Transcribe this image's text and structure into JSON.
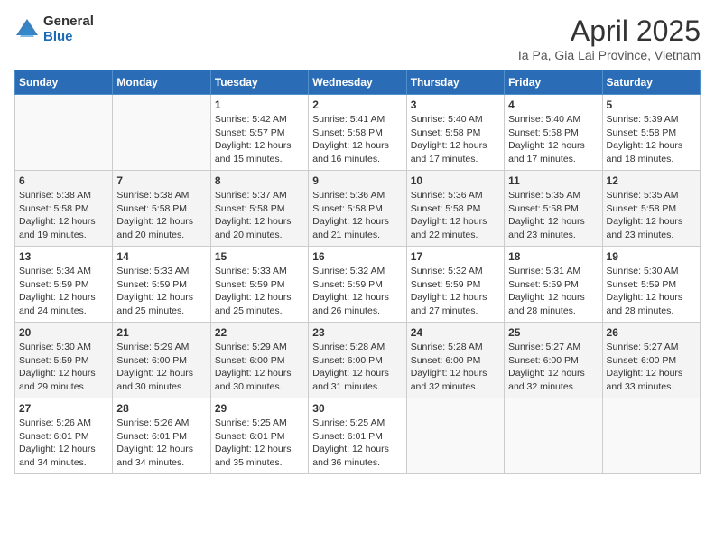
{
  "logo": {
    "general": "General",
    "blue": "Blue"
  },
  "title": "April 2025",
  "subtitle": "Ia Pa, Gia Lai Province, Vietnam",
  "weekdays": [
    "Sunday",
    "Monday",
    "Tuesday",
    "Wednesday",
    "Thursday",
    "Friday",
    "Saturday"
  ],
  "weeks": [
    [
      {
        "day": "",
        "sunrise": "",
        "sunset": "",
        "daylight": ""
      },
      {
        "day": "",
        "sunrise": "",
        "sunset": "",
        "daylight": ""
      },
      {
        "day": "1",
        "sunrise": "Sunrise: 5:42 AM",
        "sunset": "Sunset: 5:57 PM",
        "daylight": "Daylight: 12 hours and 15 minutes."
      },
      {
        "day": "2",
        "sunrise": "Sunrise: 5:41 AM",
        "sunset": "Sunset: 5:58 PM",
        "daylight": "Daylight: 12 hours and 16 minutes."
      },
      {
        "day": "3",
        "sunrise": "Sunrise: 5:40 AM",
        "sunset": "Sunset: 5:58 PM",
        "daylight": "Daylight: 12 hours and 17 minutes."
      },
      {
        "day": "4",
        "sunrise": "Sunrise: 5:40 AM",
        "sunset": "Sunset: 5:58 PM",
        "daylight": "Daylight: 12 hours and 17 minutes."
      },
      {
        "day": "5",
        "sunrise": "Sunrise: 5:39 AM",
        "sunset": "Sunset: 5:58 PM",
        "daylight": "Daylight: 12 hours and 18 minutes."
      }
    ],
    [
      {
        "day": "6",
        "sunrise": "Sunrise: 5:38 AM",
        "sunset": "Sunset: 5:58 PM",
        "daylight": "Daylight: 12 hours and 19 minutes."
      },
      {
        "day": "7",
        "sunrise": "Sunrise: 5:38 AM",
        "sunset": "Sunset: 5:58 PM",
        "daylight": "Daylight: 12 hours and 20 minutes."
      },
      {
        "day": "8",
        "sunrise": "Sunrise: 5:37 AM",
        "sunset": "Sunset: 5:58 PM",
        "daylight": "Daylight: 12 hours and 20 minutes."
      },
      {
        "day": "9",
        "sunrise": "Sunrise: 5:36 AM",
        "sunset": "Sunset: 5:58 PM",
        "daylight": "Daylight: 12 hours and 21 minutes."
      },
      {
        "day": "10",
        "sunrise": "Sunrise: 5:36 AM",
        "sunset": "Sunset: 5:58 PM",
        "daylight": "Daylight: 12 hours and 22 minutes."
      },
      {
        "day": "11",
        "sunrise": "Sunrise: 5:35 AM",
        "sunset": "Sunset: 5:58 PM",
        "daylight": "Daylight: 12 hours and 23 minutes."
      },
      {
        "day": "12",
        "sunrise": "Sunrise: 5:35 AM",
        "sunset": "Sunset: 5:58 PM",
        "daylight": "Daylight: 12 hours and 23 minutes."
      }
    ],
    [
      {
        "day": "13",
        "sunrise": "Sunrise: 5:34 AM",
        "sunset": "Sunset: 5:59 PM",
        "daylight": "Daylight: 12 hours and 24 minutes."
      },
      {
        "day": "14",
        "sunrise": "Sunrise: 5:33 AM",
        "sunset": "Sunset: 5:59 PM",
        "daylight": "Daylight: 12 hours and 25 minutes."
      },
      {
        "day": "15",
        "sunrise": "Sunrise: 5:33 AM",
        "sunset": "Sunset: 5:59 PM",
        "daylight": "Daylight: 12 hours and 25 minutes."
      },
      {
        "day": "16",
        "sunrise": "Sunrise: 5:32 AM",
        "sunset": "Sunset: 5:59 PM",
        "daylight": "Daylight: 12 hours and 26 minutes."
      },
      {
        "day": "17",
        "sunrise": "Sunrise: 5:32 AM",
        "sunset": "Sunset: 5:59 PM",
        "daylight": "Daylight: 12 hours and 27 minutes."
      },
      {
        "day": "18",
        "sunrise": "Sunrise: 5:31 AM",
        "sunset": "Sunset: 5:59 PM",
        "daylight": "Daylight: 12 hours and 28 minutes."
      },
      {
        "day": "19",
        "sunrise": "Sunrise: 5:30 AM",
        "sunset": "Sunset: 5:59 PM",
        "daylight": "Daylight: 12 hours and 28 minutes."
      }
    ],
    [
      {
        "day": "20",
        "sunrise": "Sunrise: 5:30 AM",
        "sunset": "Sunset: 5:59 PM",
        "daylight": "Daylight: 12 hours and 29 minutes."
      },
      {
        "day": "21",
        "sunrise": "Sunrise: 5:29 AM",
        "sunset": "Sunset: 6:00 PM",
        "daylight": "Daylight: 12 hours and 30 minutes."
      },
      {
        "day": "22",
        "sunrise": "Sunrise: 5:29 AM",
        "sunset": "Sunset: 6:00 PM",
        "daylight": "Daylight: 12 hours and 30 minutes."
      },
      {
        "day": "23",
        "sunrise": "Sunrise: 5:28 AM",
        "sunset": "Sunset: 6:00 PM",
        "daylight": "Daylight: 12 hours and 31 minutes."
      },
      {
        "day": "24",
        "sunrise": "Sunrise: 5:28 AM",
        "sunset": "Sunset: 6:00 PM",
        "daylight": "Daylight: 12 hours and 32 minutes."
      },
      {
        "day": "25",
        "sunrise": "Sunrise: 5:27 AM",
        "sunset": "Sunset: 6:00 PM",
        "daylight": "Daylight: 12 hours and 32 minutes."
      },
      {
        "day": "26",
        "sunrise": "Sunrise: 5:27 AM",
        "sunset": "Sunset: 6:00 PM",
        "daylight": "Daylight: 12 hours and 33 minutes."
      }
    ],
    [
      {
        "day": "27",
        "sunrise": "Sunrise: 5:26 AM",
        "sunset": "Sunset: 6:01 PM",
        "daylight": "Daylight: 12 hours and 34 minutes."
      },
      {
        "day": "28",
        "sunrise": "Sunrise: 5:26 AM",
        "sunset": "Sunset: 6:01 PM",
        "daylight": "Daylight: 12 hours and 34 minutes."
      },
      {
        "day": "29",
        "sunrise": "Sunrise: 5:25 AM",
        "sunset": "Sunset: 6:01 PM",
        "daylight": "Daylight: 12 hours and 35 minutes."
      },
      {
        "day": "30",
        "sunrise": "Sunrise: 5:25 AM",
        "sunset": "Sunset: 6:01 PM",
        "daylight": "Daylight: 12 hours and 36 minutes."
      },
      {
        "day": "",
        "sunrise": "",
        "sunset": "",
        "daylight": ""
      },
      {
        "day": "",
        "sunrise": "",
        "sunset": "",
        "daylight": ""
      },
      {
        "day": "",
        "sunrise": "",
        "sunset": "",
        "daylight": ""
      }
    ]
  ]
}
